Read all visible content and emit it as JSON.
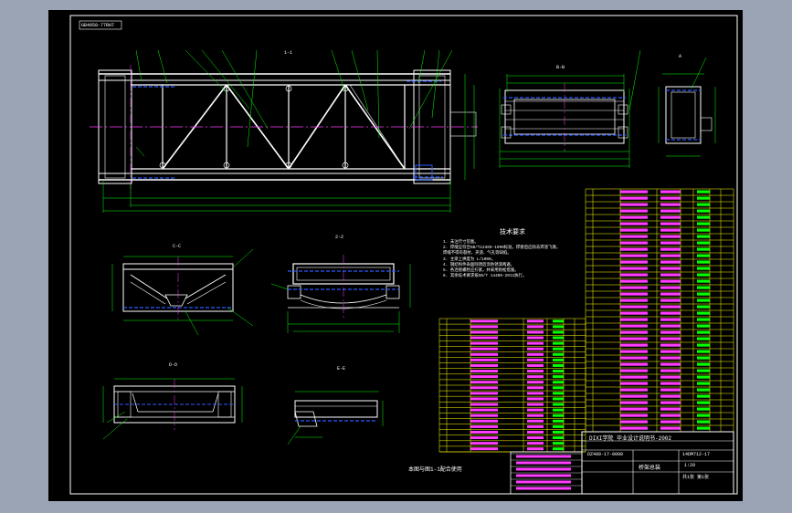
{
  "drawing": {
    "tag": "GB4058-77RH7",
    "section_labels": {
      "main_view": "1-1",
      "view_b": "B-B",
      "view_a": "A",
      "section_c": "C-C",
      "section_2": "2-2",
      "section_d": "D-D",
      "section_e": "E-E"
    },
    "notes_title": "技术要求",
    "notes": [
      "1. 未注尺寸见图。",
      "2. 焊缝应符合GB/T12469-1990标准，焊接后应除去焊渣飞溅，",
      "   焊缝不得有裂纹、夹渣、气孔等缺陷。",
      "3. 主梁上拱度为 L/1000。",
      "4. 钢结构件表面除锈后涂防锈漆两遍。",
      "5. 各连接螺栓应拧紧，并采用防松措施。",
      "6. 其余技术要求按GB/T 14405-2011执行。"
    ],
    "bottom_note": "本图与图1-1配合使用",
    "title_block": {
      "school": "DIXI学院 毕业设计说明书-2002",
      "drawing_no": "DZ400-17-0000",
      "part_no": "14DM712-17",
      "name": "桥架总装",
      "scale": "1:20",
      "sheet": "共1张 第1张"
    }
  }
}
